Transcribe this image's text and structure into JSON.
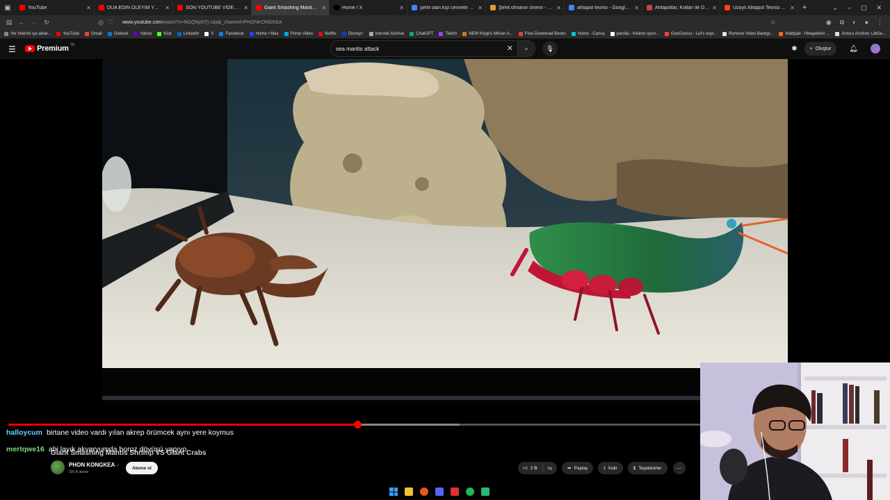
{
  "browser": {
    "tabs": [
      {
        "label": "YouTube",
        "color": "#ff0000",
        "active": false
      },
      {
        "label": "DUA EDİN ÖLEYİM YOKSA ÇOK",
        "color": "#ff0000",
        "active": false
      },
      {
        "label": "SON YOUTUBE VİDEOM - YouT",
        "color": "#ff0000",
        "active": false
      },
      {
        "label": "Giant Smashing Mantis Shrimp",
        "color": "#ff0000",
        "active": true
      },
      {
        "label": "Home / X",
        "color": "#000000",
        "active": false
      },
      {
        "label": "şehit olan kişi cennete mi gider",
        "color": "#4285f4",
        "active": false
      },
      {
        "label": "Şehit olmanın önemi - Dinimiz",
        "color": "#e0a030",
        "active": false
      },
      {
        "label": "ahtapot teorisi - Google Search",
        "color": "#4285f4",
        "active": false
      },
      {
        "label": "Ahtapotlar, Kolları ile Düşünür!",
        "color": "#d04040",
        "active": false
      },
      {
        "label": "Uzaylı Ahtapot Teorisi mi? : r/b",
        "color": "#ff4500",
        "active": false
      }
    ],
    "new_tab": "+",
    "url_host": "www.youtube.com",
    "url_path": "/watch?v=NGQhpI0Tj-c&ab_channel=PHONKONGKEA",
    "bookmarks": [
      {
        "label": "Yer imlerini içe aktar...",
        "color": "#888888"
      },
      {
        "label": "YouTube",
        "color": "#ff0000"
      },
      {
        "label": "Gmail",
        "color": "#ea4335"
      },
      {
        "label": "Outlook",
        "color": "#0078d4"
      },
      {
        "label": "Yahoo",
        "color": "#6001d2"
      },
      {
        "label": "Kick",
        "color": "#53fc18"
      },
      {
        "label": "LinkedIn",
        "color": "#0a66c2"
      },
      {
        "label": "X",
        "color": "#ffffff"
      },
      {
        "label": "Facebook",
        "color": "#1877f2"
      },
      {
        "label": "Home • Max",
        "color": "#2a3bff"
      },
      {
        "label": "Prime Video",
        "color": "#00a8e1"
      },
      {
        "label": "Netflix",
        "color": "#e50914"
      },
      {
        "label": "Disney+",
        "color": "#113ccf"
      },
      {
        "label": "Internet Archive",
        "color": "#aaaaaa"
      },
      {
        "label": "ChatGPT",
        "color": "#10a37f"
      },
      {
        "label": "Twitch",
        "color": "#9146ff"
      },
      {
        "label": "NEW Kripp's Minion A...",
        "color": "#c08030"
      },
      {
        "label": "Free Download Books",
        "color": "#e04040"
      },
      {
        "label": "Home - Canva",
        "color": "#00c4cc"
      },
      {
        "label": "parolla - Kelime oyun...",
        "color": "#ffffff"
      },
      {
        "label": "GeoGuessr - Let's expl...",
        "color": "#ff3b30"
      },
      {
        "label": "Remove Video Backgr...",
        "color": "#e0e0e0"
      },
      {
        "label": "Wattpad - Hikayelerin ...",
        "color": "#ff6122"
      },
      {
        "label": "Anna's Archive: LibGe...",
        "color": "#dddddd"
      }
    ]
  },
  "youtube": {
    "logo_text": "Premium",
    "country": "TR",
    "search_query": "sea mantis attack",
    "create_label": "Oluştur",
    "progress_fraction": 0.505,
    "buffer_fraction": 0.652
  },
  "chat": [
    {
      "user": "halloycum",
      "message": "birtane video vardı yılan akrep örümcek aynı yere koymus"
    },
    {
      "user": "mertqwe16",
      "message": "abi layık akvaryumda horoz dövüşü yapıyo"
    }
  ],
  "video": {
    "title": "Giant Smashing Mantis Shrimp VS Giant Crabs",
    "channel_name": "PHON KONGKEA",
    "verified_mark": "✓",
    "subscribers": "230 B abone",
    "subscribe_label": "Abone ol",
    "likes": "2 B",
    "share_label": "Paylaş",
    "download_label": "İndir",
    "thanks_label": "Teşekkürler",
    "more_label": "⋯"
  }
}
